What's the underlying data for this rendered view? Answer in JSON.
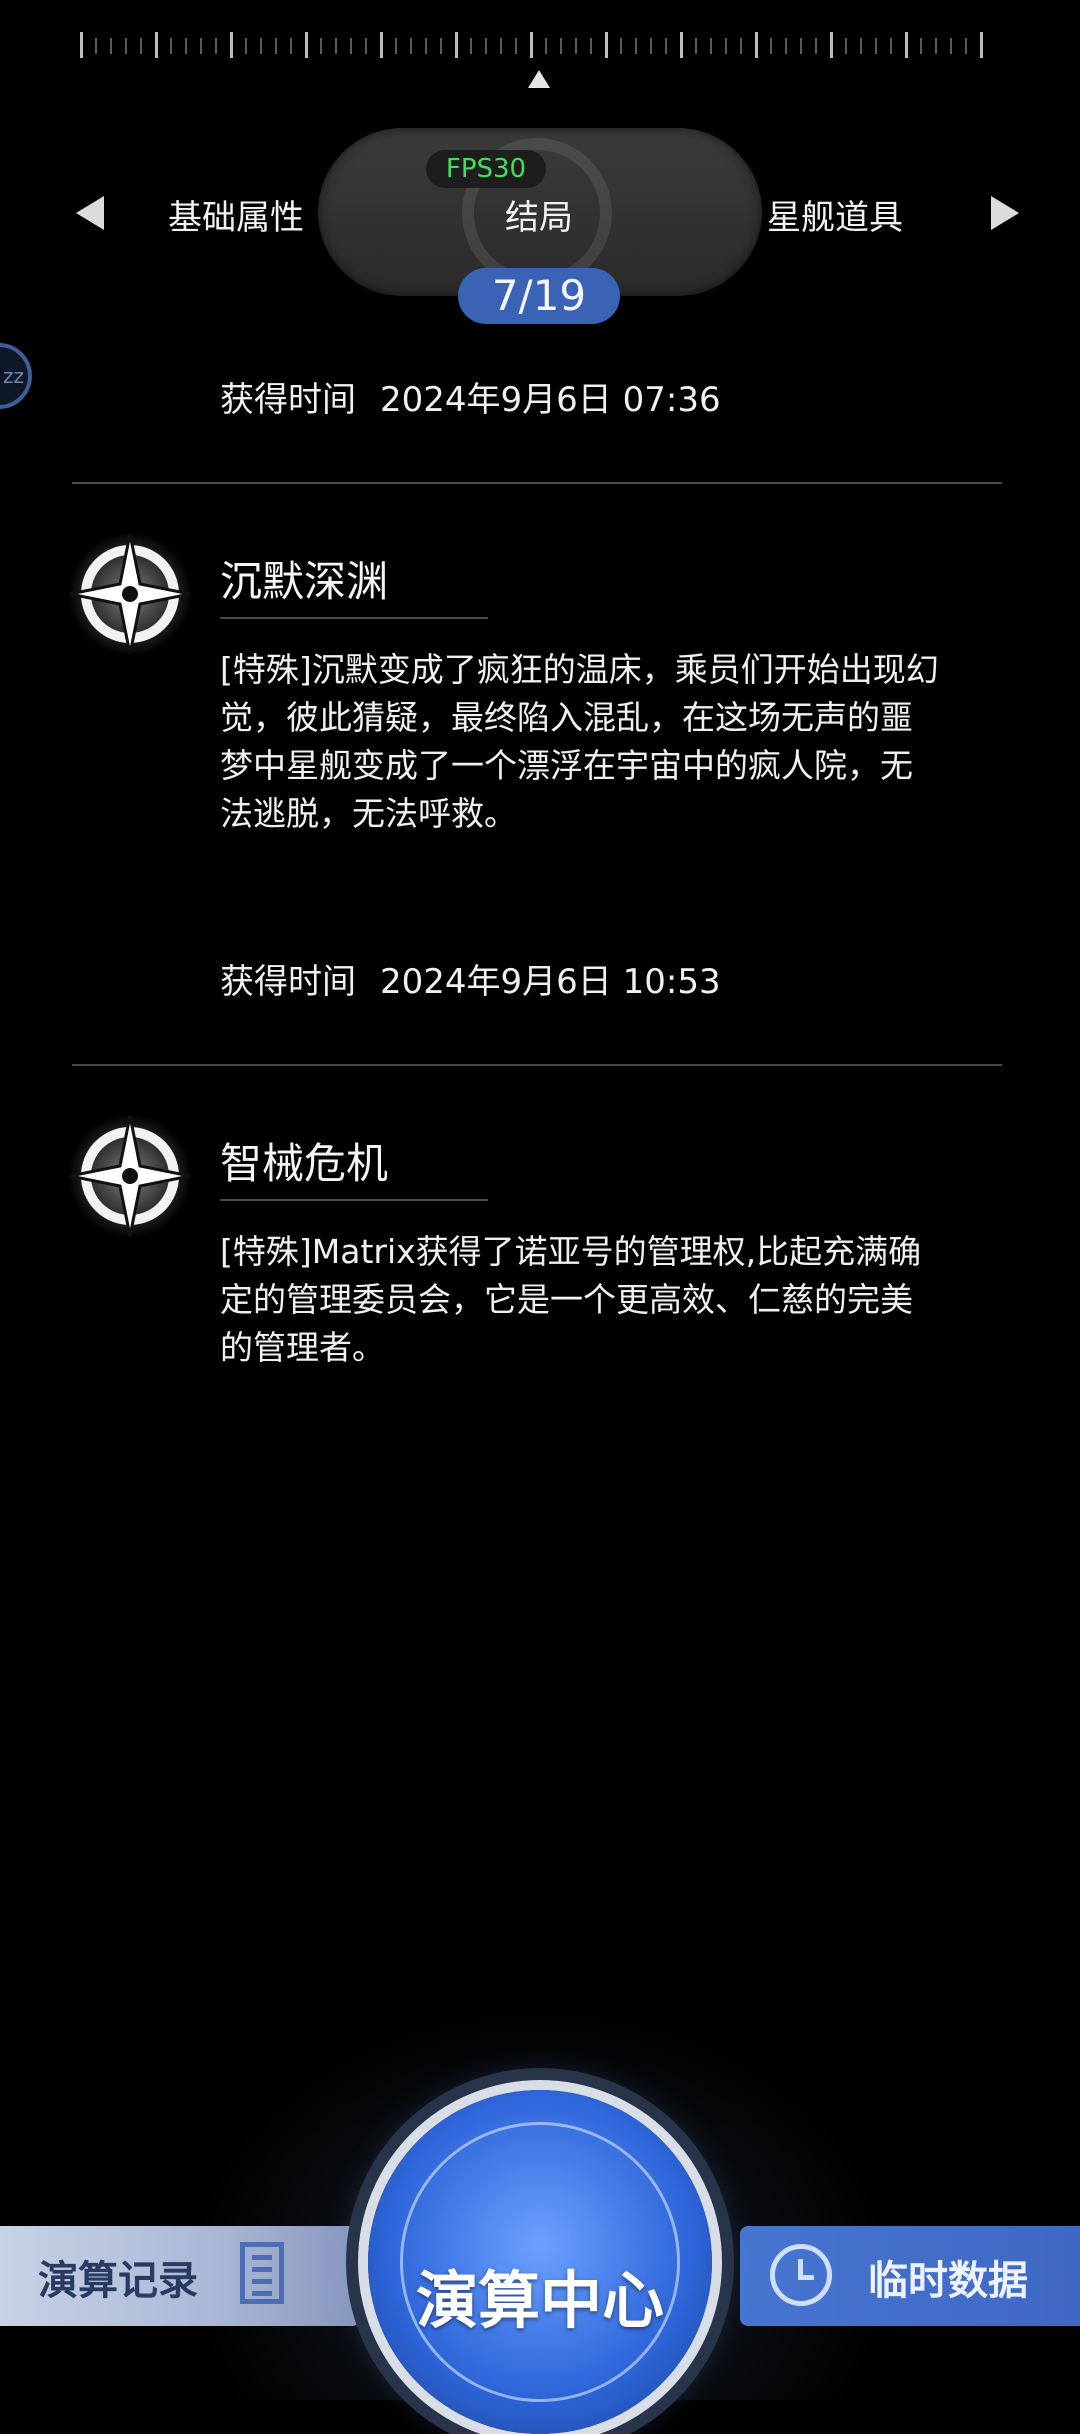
{
  "header": {
    "fps": "FPS30",
    "tabs": [
      {
        "label": "基础属性"
      },
      {
        "label": "结局"
      },
      {
        "label": "星舰道具"
      }
    ],
    "page_counter": "7/19"
  },
  "entries": [
    {
      "time_label": "获得时间",
      "time_value": "2024年9月6日 07:36"
    },
    {
      "title": "沉默深渊",
      "description": "[特殊]沉默变成了疯狂的温床，乘员们开始出现幻觉，彼此猜疑，最终陷入混乱，在这场无声的噩梦中星舰变成了一个漂浮在宇宙中的疯人院，无法逃脱，无法呼救。",
      "time_label": "获得时间",
      "time_value": "2024年9月6日 10:53"
    },
    {
      "title": "智械危机",
      "description": "[特殊]Matrix获得了诺亚号的管理权,比起充满确定的管理委员会，它是一个更高效、仁慈的完美的管理者。"
    }
  ],
  "side_button": "zz",
  "bottom_bar": {
    "left_label": "演算记录",
    "center_label": "演算中心",
    "right_label": "临时数据"
  },
  "colors": {
    "counter_bg": "#3a63b5",
    "fps_text": "#3fe05a",
    "right_panel": "#4775d0"
  }
}
